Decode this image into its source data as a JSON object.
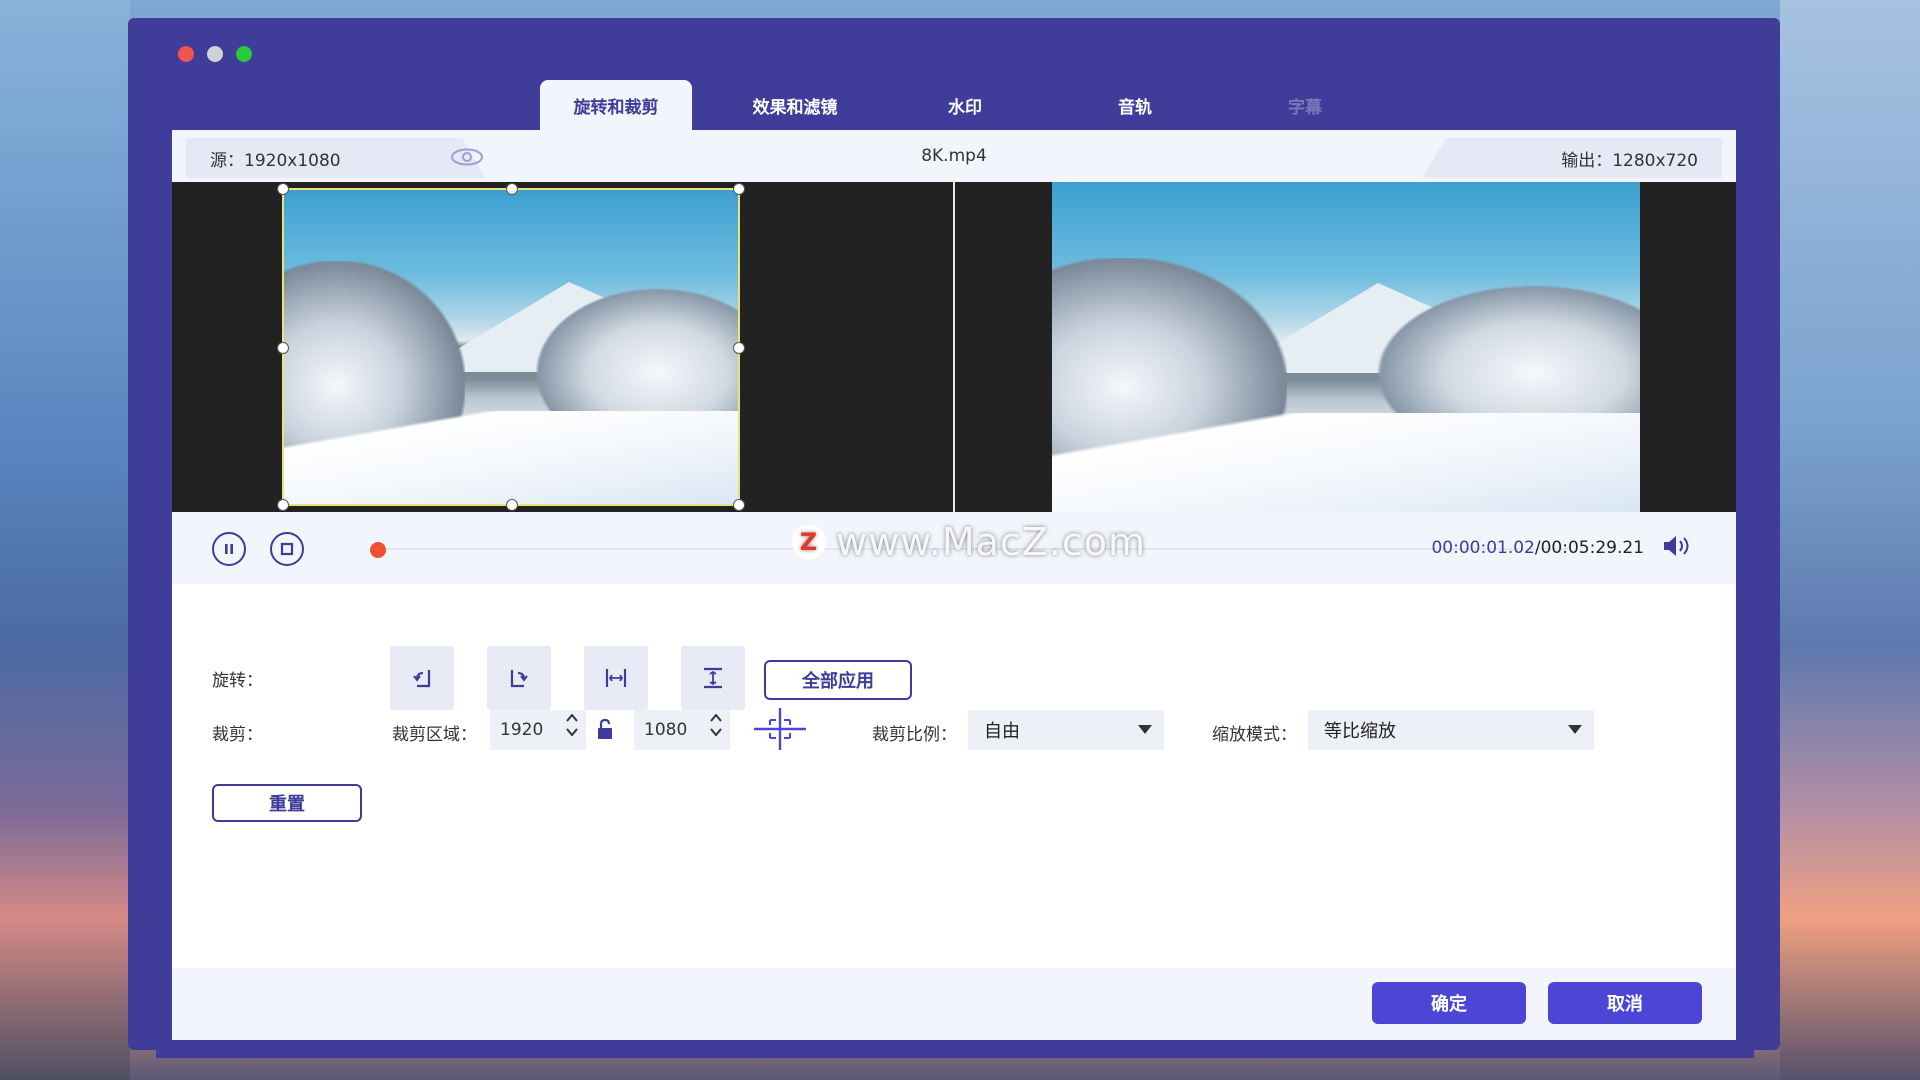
{
  "tabs": [
    {
      "label": "旋转和裁剪",
      "state": "active"
    },
    {
      "label": "效果和滤镜",
      "state": "normal"
    },
    {
      "label": "水印",
      "state": "normal"
    },
    {
      "label": "音轨",
      "state": "normal"
    },
    {
      "label": "字幕",
      "state": "disabled"
    }
  ],
  "info": {
    "source": "源：1920x1080",
    "filename": "8K.mp4",
    "output": "输出：1280x720"
  },
  "player": {
    "current_time": "00:00:01.02",
    "separator": "/",
    "total_time": "00:05:29.21",
    "progress_fraction": 0.003
  },
  "watermark": {
    "logo": "Z",
    "text": "www.MacZ.com"
  },
  "rotate": {
    "label": "旋转：",
    "apply_all": "全部应用"
  },
  "crop": {
    "label": "裁剪：",
    "area_label": "裁剪区域：",
    "width": "1920",
    "height": "1080",
    "ratio_label": "裁剪比例：",
    "ratio_value": "自由",
    "zoom_label": "缩放模式：",
    "zoom_value": "等比缩放",
    "reset": "重置"
  },
  "footer": {
    "confirm": "确定",
    "cancel": "取消"
  },
  "colors": {
    "accent": "#3e3c9a",
    "primary_button": "#4b46d6",
    "progress_knob": "#f14f30"
  }
}
